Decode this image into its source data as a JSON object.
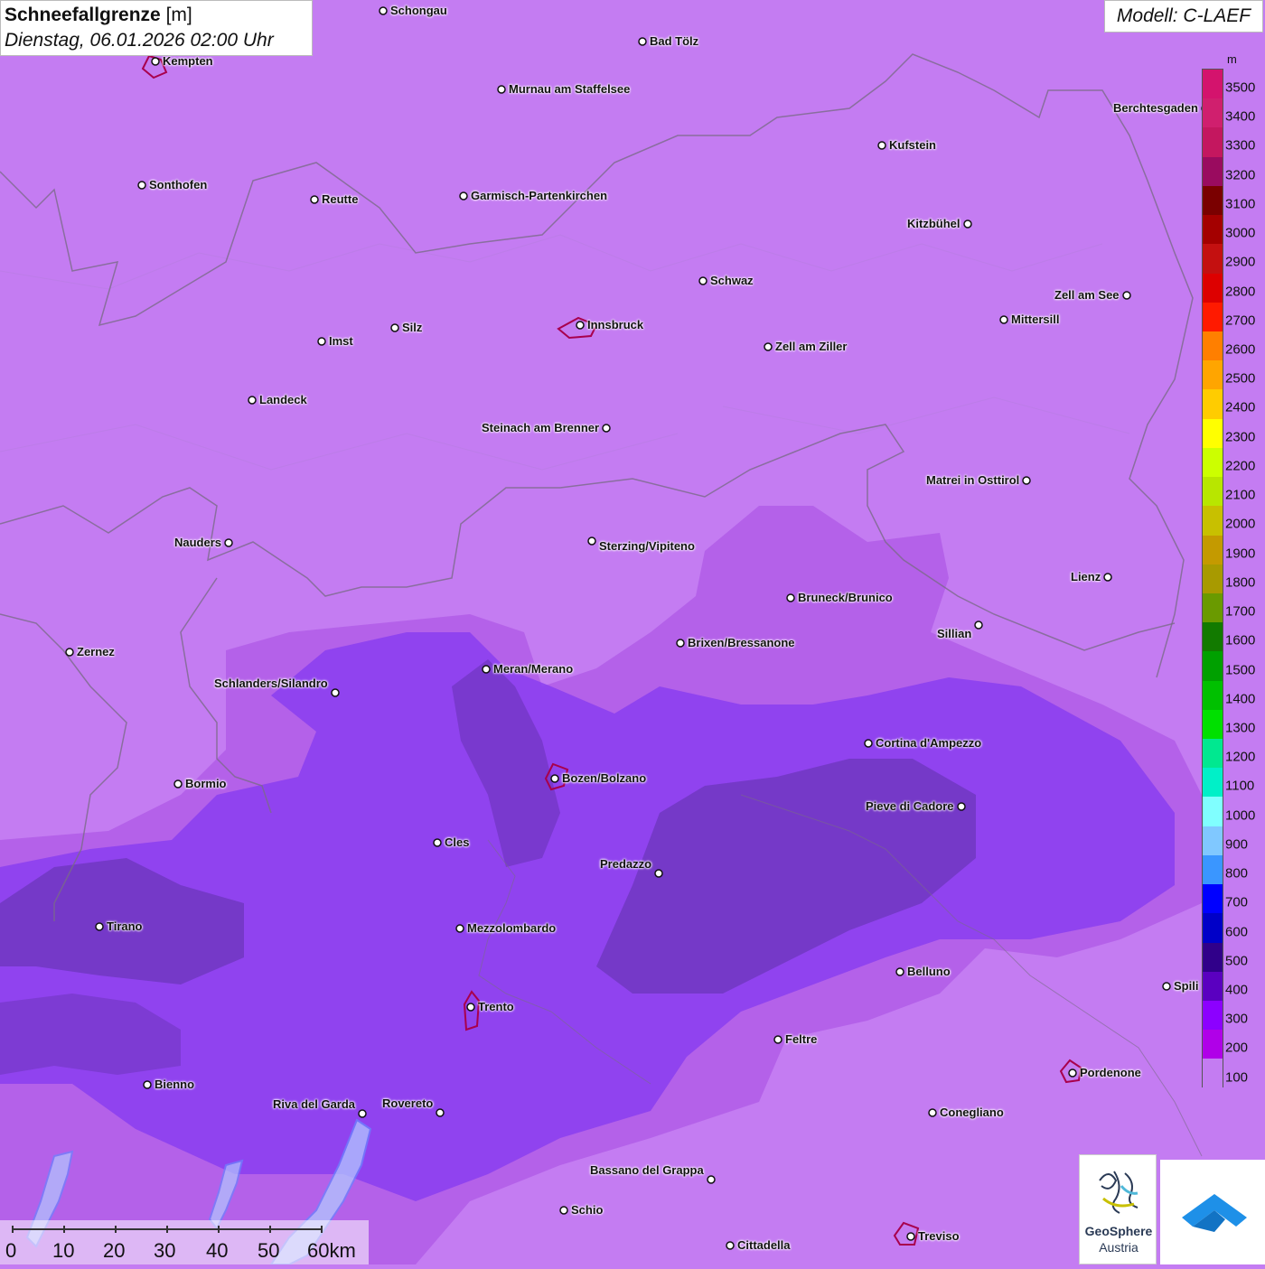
{
  "header": {
    "title": "Schneefallgrenze",
    "unit": "[m]",
    "datetime": "Dienstag, 06.01.2026 02:00 Uhr"
  },
  "model": "Modell: C-LAEF",
  "legend": {
    "unit": "m",
    "ticks": [
      "3500",
      "3400",
      "3300",
      "3200",
      "3100",
      "3000",
      "2900",
      "2800",
      "2700",
      "2600",
      "2500",
      "2400",
      "2300",
      "2200",
      "2100",
      "2000",
      "1900",
      "1800",
      "1700",
      "1600",
      "1500",
      "1400",
      "1300",
      "1200",
      "1100",
      "1000",
      "900",
      "800",
      "700",
      "600",
      "500",
      "400",
      "300",
      "200",
      "100"
    ],
    "colors": [
      "#d4136d",
      "#d01f6e",
      "#c4175f",
      "#9a0b5f",
      "#7a0000",
      "#a40000",
      "#c41010",
      "#dd0000",
      "#ff1a00",
      "#ff7f00",
      "#ffa500",
      "#ffcc00",
      "#ffff00",
      "#ccff00",
      "#b8e600",
      "#c8c000",
      "#c49a00",
      "#a89a00",
      "#6a9a00",
      "#127a00",
      "#00a000",
      "#00c000",
      "#00e000",
      "#00e890",
      "#00f0c8",
      "#80ffff",
      "#80c8ff",
      "#3a96ff",
      "#0000ff",
      "#0000c8",
      "#30008a",
      "#5a00c0",
      "#8c00ff",
      "#b000e8",
      "#c47cf2"
    ]
  },
  "cities": [
    {
      "name": "Schongau"
    },
    {
      "name": "Bad Tölz"
    },
    {
      "name": "Kempten"
    },
    {
      "name": "Murnau am Staffelsee"
    },
    {
      "name": "Berchtesgaden"
    },
    {
      "name": "Kufstein"
    },
    {
      "name": "Sonthofen"
    },
    {
      "name": "Reutte"
    },
    {
      "name": "Garmisch-Partenkirchen"
    },
    {
      "name": "Kitzbühel"
    },
    {
      "name": "Schwaz"
    },
    {
      "name": "Zell am See"
    },
    {
      "name": "Innsbruck"
    },
    {
      "name": "Mittersill"
    },
    {
      "name": "Silz"
    },
    {
      "name": "Imst"
    },
    {
      "name": "Zell am Ziller"
    },
    {
      "name": "Landeck"
    },
    {
      "name": "Steinach am Brenner"
    },
    {
      "name": "Matrei in Osttirol"
    },
    {
      "name": "Nauders"
    },
    {
      "name": "Sterzing/Vipiteno"
    },
    {
      "name": "Lienz"
    },
    {
      "name": "Bruneck/Brunico"
    },
    {
      "name": "Sillian"
    },
    {
      "name": "Brixen/Bressanone"
    },
    {
      "name": "Zernez"
    },
    {
      "name": "Meran/Merano"
    },
    {
      "name": "Schlanders/Silandro"
    },
    {
      "name": "Cortina d'Ampezzo"
    },
    {
      "name": "Bozen/Bolzano"
    },
    {
      "name": "Bormio"
    },
    {
      "name": "Pieve di Cadore"
    },
    {
      "name": "Cles"
    },
    {
      "name": "Predazzo"
    },
    {
      "name": "Tirano"
    },
    {
      "name": "Mezzolombardo"
    },
    {
      "name": "Belluno"
    },
    {
      "name": "Spili"
    },
    {
      "name": "Trento"
    },
    {
      "name": "Feltre"
    },
    {
      "name": "Pordenone"
    },
    {
      "name": "Bienno"
    },
    {
      "name": "Riva del Garda"
    },
    {
      "name": "Rovereto"
    },
    {
      "name": "Conegliano"
    },
    {
      "name": "Bassano del Grappa"
    },
    {
      "name": "Schio"
    },
    {
      "name": "Treviso"
    },
    {
      "name": "Cittadella"
    }
  ],
  "scale": {
    "labels": [
      "0",
      "10",
      "20",
      "30",
      "40",
      "50",
      "60km"
    ]
  },
  "logos": {
    "geosphere_line1": "GeoSphere",
    "geosphere_line2": "Austria"
  }
}
